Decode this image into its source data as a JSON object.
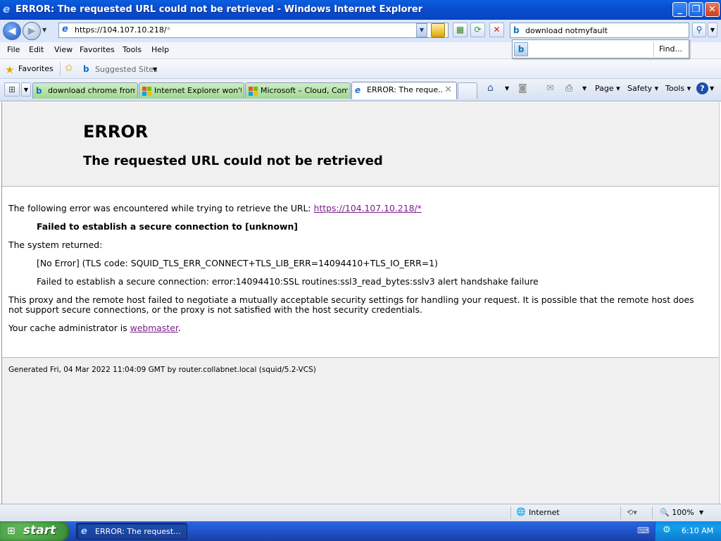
{
  "window": {
    "title": "ERROR: The requested URL could not be retrieved - Windows Internet Explorer",
    "min": "_",
    "max": "❐",
    "close": "✕"
  },
  "address": {
    "scheme": "https://104.107.10.218/",
    "rest": "*"
  },
  "search": {
    "query": "download notmyfault",
    "find_label": "Find..."
  },
  "menu": [
    "File",
    "Edit",
    "View",
    "Favorites",
    "Tools",
    "Help"
  ],
  "favorites_bar": {
    "favorites_label": "Favorites",
    "suggested_label": "Suggested Sites"
  },
  "tabs": [
    {
      "label": "download chrome from ..."
    },
    {
      "label": "Internet Explorer won't..."
    },
    {
      "label": "Microsoft – Cloud, Com..."
    },
    {
      "label": "ERROR: The reque..."
    }
  ],
  "command_bar": {
    "page": "Page",
    "safety": "Safety",
    "tools": "Tools"
  },
  "page": {
    "h1": "ERROR",
    "h2": "The requested URL could not be retrieved",
    "intro": "The following error was encountered while trying to retrieve the URL: ",
    "intro_link": "https://104.107.10.218/*",
    "failed": "Failed to establish a secure connection to [unknown]",
    "system_returned": "The system returned:",
    "noerror": "[No Error] (TLS code: SQUID_TLS_ERR_CONNECT+TLS_LIB_ERR=14094410+TLS_IO_ERR=1)",
    "ssl_detail": "Failed to establish a secure connection: error:14094410:SSL routines:ssl3_read_bytes:sslv3 alert handshake failure",
    "explain_line1": "This proxy and the remote host failed to negotiate a mutually acceptable security settings for handling your request. It is possible that the remote host does",
    "explain_line2": "not support secure connections, or the proxy is not satisfied with the host security credentials.",
    "admin_prefix": "Your cache administrator is ",
    "admin_link": "webmaster",
    "admin_suffix": ".",
    "footer": "Generated Fri, 04 Mar 2022 11:04:09 GMT by router.collabnet.local (squid/5.2-VCS)"
  },
  "status": {
    "zone": "Internet",
    "zoom": "100%"
  },
  "taskbar": {
    "start": "start",
    "task": "ERROR: The request...",
    "clock": "6:10 AM"
  }
}
